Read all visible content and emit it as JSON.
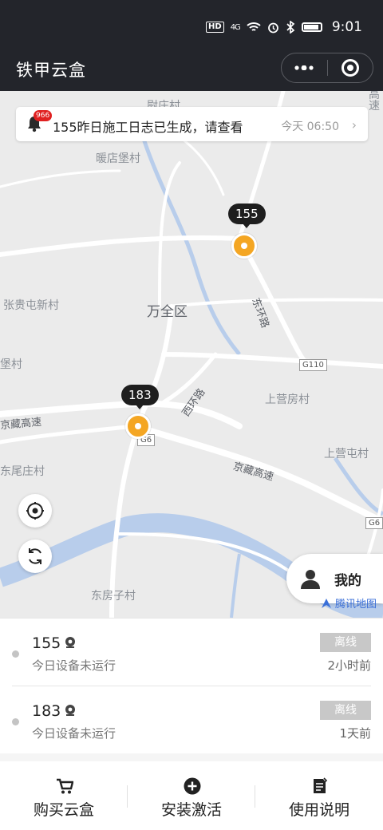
{
  "status_bar": {
    "time": "9:01",
    "network": "4G",
    "hd": "HD"
  },
  "app": {
    "title": "铁甲云盒"
  },
  "notice": {
    "badge": "966",
    "text": "155昨日施工日志已生成，请查看",
    "time": "今天 06:50"
  },
  "map": {
    "district": "万全区",
    "places": [
      "暖店堡村",
      "张贵屯新村",
      "上营房村",
      "上营屯村",
      "东房子村",
      "尉庄村",
      "堡村",
      "东尾庄村",
      "高速"
    ],
    "roads": [
      "京藏高速",
      "京藏高速",
      "东环路",
      "西环路"
    ],
    "road_shields": [
      "G110",
      "G6",
      "G6"
    ],
    "markers": [
      {
        "label": "155"
      },
      {
        "label": "183"
      }
    ],
    "mine_label": "我的",
    "provider": "腾讯地图"
  },
  "devices": [
    {
      "name": "155",
      "sub": "今日设备未运行",
      "status": "离线",
      "ago": "2小时前"
    },
    {
      "name": "183",
      "sub": "今日设备未运行",
      "status": "离线",
      "ago": "1天前"
    }
  ],
  "bottom_nav": [
    {
      "label": "购买云盒"
    },
    {
      "label": "安装激活"
    },
    {
      "label": "使用说明"
    }
  ],
  "colors": {
    "header": "#23252b",
    "marker": "#f4a623",
    "offline": "#c8c8c8"
  }
}
